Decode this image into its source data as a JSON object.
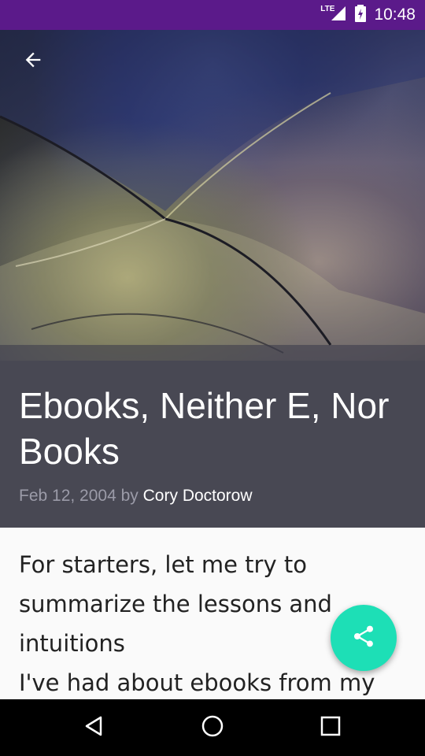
{
  "status_bar": {
    "network": "LTE",
    "time": "10:48"
  },
  "toolbar": {
    "back_icon": "arrow-back-icon"
  },
  "article": {
    "title": "Ebooks, Neither E, Nor Books",
    "date": "Feb 12, 2004",
    "by_word": "by",
    "author": "Cory Doctorow",
    "body": "For starters, let me try to summarize the lessons and intuitions\nI've had about ebooks from my"
  },
  "fab": {
    "icon": "share-icon",
    "color": "#1ddfb6"
  },
  "navigation": {
    "back_icon": "nav-back-icon",
    "home_icon": "nav-home-icon",
    "recents_icon": "nav-recents-icon"
  },
  "colors": {
    "status_bar": "#5b1a8a",
    "title_panel": "#484853",
    "accent": "#1ddfb6"
  }
}
